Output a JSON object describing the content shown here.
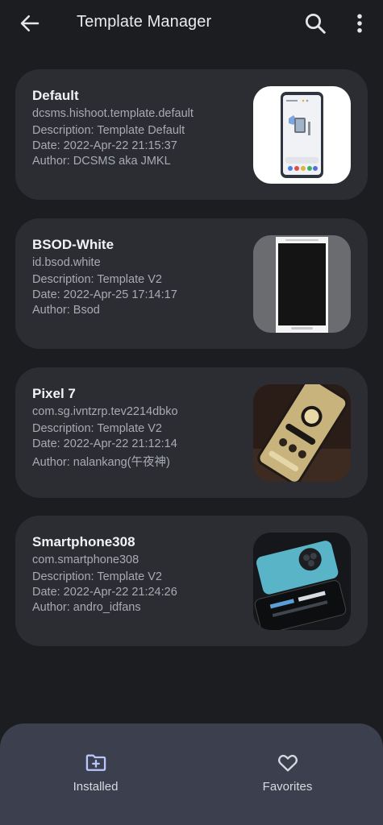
{
  "appbar": {
    "title": "Template Manager",
    "back_icon": "arrow-back-icon",
    "search_icon": "search-icon",
    "more_icon": "more-vertical-icon"
  },
  "templates": [
    {
      "name": "Default",
      "package": "dcsms.hishoot.template.default",
      "description": "Description: Template Default",
      "date": "Date: 2022-Apr-22 21:15:37",
      "author": "Author: DCSMS aka JMKL"
    },
    {
      "name": "BSOD-White",
      "package": "id.bsod.white",
      "description": "Description: Template V2",
      "date": "Date: 2022-Apr-25 17:14:17",
      "author": "Author: Bsod"
    },
    {
      "name": "Pixel 7",
      "package": "com.sg.ivntzrp.tev2214dbko",
      "description": "Description: Template V2",
      "date": "Date: 2022-Apr-22 21:12:14",
      "author": "Author: nalankang(午夜神)"
    },
    {
      "name": "Smartphone308",
      "package": "com.smartphone308",
      "description": "Description: Template V2",
      "date": "Date: 2022-Apr-22 21:24:26",
      "author": "Author: andro_idfans"
    }
  ],
  "bottom_nav": {
    "items": [
      {
        "label": "Installed",
        "icon": "folder-add-icon"
      },
      {
        "label": "Favorites",
        "icon": "heart-outline-icon"
      }
    ]
  },
  "colors": {
    "background": "#1c1d21",
    "card": "#2b2d33",
    "bottom_nav": "#3c3f4d",
    "accent": "#b8c6ff"
  }
}
